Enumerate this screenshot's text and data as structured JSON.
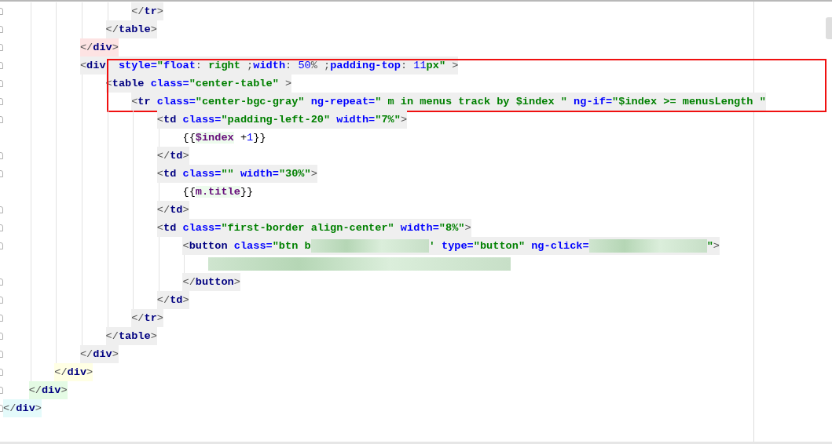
{
  "editor": {
    "lines": [
      {
        "children": [
          {
            "children": [
              {
                "children": [
                  {
                    "children": [
                      {
                        "children": [
                          {
                            "color": "#efefef",
                            "marked": false,
                            "tokens": [
                              {
                                "kind": "punct",
                                "text": "</"
                              },
                              {
                                "kind": "tag",
                                "text": "tr"
                              },
                              {
                                "kind": "punct",
                                "text": ">"
                              }
                            ]
                          }
                        ]
                      },
                      {
                        "color": "#efefef",
                        "marked": false,
                        "tokens": [
                          {
                            "kind": "punct",
                            "text": "</"
                          },
                          {
                            "kind": "tag",
                            "text": "table"
                          },
                          {
                            "kind": "punct",
                            "text": ">"
                          }
                        ]
                      }
                    ]
                  },
                  {
                    "color": "#fde3e3",
                    "marked": false,
                    "tokens": [
                      {
                        "kind": "punct",
                        "text": "</"
                      },
                      {
                        "kind": "tag",
                        "text": "div"
                      },
                      {
                        "kind": "punct",
                        "text": ">"
                      }
                    ]
                  },
                  {
                    "color": "#efefef",
                    "marked": true,
                    "tokens": [
                      {
                        "kind": "punct",
                        "text": "<"
                      },
                      {
                        "kind": "tag",
                        "text": "div"
                      },
                      {
                        "kind": "attr",
                        "text": "  style="
                      },
                      {
                        "kind": "value",
                        "text": "\""
                      },
                      {
                        "kind": "attr",
                        "text": "float"
                      },
                      {
                        "kind": "punct",
                        "text": ": "
                      },
                      {
                        "kind": "value",
                        "text": "right "
                      },
                      {
                        "kind": "punct",
                        "text": ";"
                      },
                      {
                        "kind": "attr",
                        "text": "width"
                      },
                      {
                        "kind": "punct",
                        "text": ": "
                      },
                      {
                        "kind": "number",
                        "text": "50"
                      },
                      {
                        "kind": "punct",
                        "text": "% ;"
                      },
                      {
                        "kind": "attr",
                        "text": "padding-top"
                      },
                      {
                        "kind": "punct",
                        "text": ": "
                      },
                      {
                        "kind": "number",
                        "text": "11"
                      },
                      {
                        "kind": "value",
                        "text": "px\""
                      },
                      {
                        "kind": "punct",
                        "text": " >"
                      }
                    ],
                    "children": [
                      {
                        "color": "#efefef",
                        "marked": true,
                        "tokens": [
                          {
                            "kind": "punct",
                            "text": "<"
                          },
                          {
                            "kind": "tag",
                            "text": "table"
                          },
                          {
                            "kind": "attr",
                            "text": " class="
                          },
                          {
                            "kind": "value",
                            "text": "\"center-table\""
                          },
                          {
                            "kind": "punct",
                            "text": " >"
                          }
                        ],
                        "children": [
                          {
                            "color": "#efefef",
                            "marked": true,
                            "tokens": [
                              {
                                "kind": "punct",
                                "text": "<"
                              },
                              {
                                "kind": "tag",
                                "text": "tr"
                              },
                              {
                                "kind": "attr",
                                "text": " class="
                              },
                              {
                                "kind": "value",
                                "text": "\"center-bgc-gray\""
                              },
                              {
                                "kind": "attr",
                                "text": " ng-repeat="
                              },
                              {
                                "kind": "value",
                                "text": "\" m in menus track by $index \""
                              },
                              {
                                "kind": "attr",
                                "text": " ng-if="
                              },
                              {
                                "kind": "value",
                                "text": "\"$index >= menusLength \""
                              }
                            ],
                            "children": [
                              {
                                "color": "#efefef",
                                "marked": false,
                                "tokens": [
                                  {
                                    "kind": "punct",
                                    "text": "<"
                                  },
                                  {
                                    "kind": "tag",
                                    "text": "td"
                                  },
                                  {
                                    "kind": "attr",
                                    "text": " class="
                                  },
                                  {
                                    "kind": "value",
                                    "text": "\"padding-left-20\""
                                  },
                                  {
                                    "kind": "attr",
                                    "text": " width="
                                  },
                                  {
                                    "kind": "value",
                                    "text": "\"7%\""
                                  },
                                  {
                                    "kind": "punct",
                                    "text": ">"
                                  }
                                ],
                                "children": [
                                  {
                                    "color": "#ffffff",
                                    "marked": false,
                                    "tokens": [
                                      {
                                        "kind": "plain",
                                        "text": "{{"
                                      },
                                      {
                                        "kind": "var",
                                        "text": "$index"
                                      },
                                      {
                                        "kind": "plain",
                                        "text": " +"
                                      },
                                      {
                                        "kind": "number",
                                        "text": "1"
                                      },
                                      {
                                        "kind": "plain",
                                        "text": "}}"
                                      }
                                    ]
                                  }
                                ]
                              },
                              {
                                "color": "#efefef",
                                "marked": false,
                                "tokens": [
                                  {
                                    "kind": "punct",
                                    "text": "</"
                                  },
                                  {
                                    "kind": "tag",
                                    "text": "td"
                                  },
                                  {
                                    "kind": "punct",
                                    "text": ">"
                                  }
                                ]
                              },
                              {
                                "color": "#efefef",
                                "marked": false,
                                "tokens": [
                                  {
                                    "kind": "punct",
                                    "text": "<"
                                  },
                                  {
                                    "kind": "tag",
                                    "text": "td"
                                  },
                                  {
                                    "kind": "attr",
                                    "text": " class="
                                  },
                                  {
                                    "kind": "value",
                                    "text": "\"\""
                                  },
                                  {
                                    "kind": "attr",
                                    "text": " width="
                                  },
                                  {
                                    "kind": "value",
                                    "text": "\"30%\""
                                  },
                                  {
                                    "kind": "punct",
                                    "text": ">"
                                  }
                                ],
                                "children": [
                                  {
                                    "color": "#ffffff",
                                    "marked": false,
                                    "tokens": [
                                      {
                                        "kind": "plain",
                                        "text": "{{"
                                      },
                                      {
                                        "kind": "var",
                                        "text": "m.title"
                                      },
                                      {
                                        "kind": "plain",
                                        "text": "}}"
                                      }
                                    ]
                                  }
                                ]
                              },
                              {
                                "color": "#efefef",
                                "marked": false,
                                "tokens": [
                                  {
                                    "kind": "punct",
                                    "text": "</"
                                  },
                                  {
                                    "kind": "tag",
                                    "text": "td"
                                  },
                                  {
                                    "kind": "punct",
                                    "text": ">"
                                  }
                                ]
                              },
                              {
                                "color": "#efefef",
                                "marked": false,
                                "tokens": [
                                  {
                                    "kind": "punct",
                                    "text": "<"
                                  },
                                  {
                                    "kind": "tag",
                                    "text": "td"
                                  },
                                  {
                                    "kind": "attr",
                                    "text": " class="
                                  },
                                  {
                                    "kind": "value",
                                    "text": "\"first-border align-center\""
                                  },
                                  {
                                    "kind": "attr",
                                    "text": " width="
                                  },
                                  {
                                    "kind": "value",
                                    "text": "\"8%\""
                                  },
                                  {
                                    "kind": "punct",
                                    "text": ">"
                                  }
                                ],
                                "children": [
                                  {
                                    "color": "#efefef",
                                    "marked": false,
                                    "tokens": [
                                      {
                                        "kind": "punct",
                                        "text": "<"
                                      },
                                      {
                                        "kind": "tag",
                                        "text": "button"
                                      },
                                      {
                                        "kind": "attr",
                                        "text": " class="
                                      },
                                      {
                                        "kind": "value",
                                        "text": "\"btn b"
                                      },
                                      {
                                        "kind": "redacted"
                                      },
                                      {
                                        "kind": "value",
                                        "text": "'"
                                      },
                                      {
                                        "kind": "attr",
                                        "text": " type="
                                      },
                                      {
                                        "kind": "value",
                                        "text": "\"button\""
                                      },
                                      {
                                        "kind": "attr",
                                        "text": " ng-click="
                                      },
                                      {
                                        "kind": "redacted"
                                      },
                                      {
                                        "kind": "value",
                                        "text": "\""
                                      },
                                      {
                                        "kind": "punct",
                                        "text": ">"
                                      }
                                    ],
                                    "children": [
                                      {
                                        "color": "#ffffff",
                                        "marked": false,
                                        "tokens": [
                                          {
                                            "kind": "redacted"
                                          }
                                        ]
                                      }
                                    ]
                                  },
                                  {
                                    "color": "#efefef",
                                    "marked": false,
                                    "tokens": [
                                      {
                                        "kind": "punct",
                                        "text": "</"
                                      },
                                      {
                                        "kind": "tag",
                                        "text": "button"
                                      },
                                      {
                                        "kind": "punct",
                                        "text": ">"
                                      }
                                    ]
                                  }
                                ]
                              },
                              {
                                "color": "#efefef",
                                "marked": false,
                                "tokens": [
                                  {
                                    "kind": "punct",
                                    "text": "</"
                                  },
                                  {
                                    "kind": "tag",
                                    "text": "td"
                                  },
                                  {
                                    "kind": "punct",
                                    "text": ">"
                                  }
                                ]
                              }
                            ]
                          },
                          {
                            "color": "#efefef",
                            "marked": false,
                            "tokens": [
                              {
                                "kind": "punct",
                                "text": "</"
                              },
                              {
                                "kind": "tag",
                                "text": "tr"
                              },
                              {
                                "kind": "punct",
                                "text": ">"
                              }
                            ]
                          }
                        ]
                      },
                      {
                        "color": "#efefef",
                        "marked": false,
                        "tokens": [
                          {
                            "kind": "punct",
                            "text": "</"
                          },
                          {
                            "kind": "tag",
                            "text": "table"
                          },
                          {
                            "kind": "punct",
                            "text": ">"
                          }
                        ]
                      }
                    ]
                  },
                  {
                    "color": "#efefef",
                    "marked": false,
                    "tokens": [
                      {
                        "kind": "punct",
                        "text": "</"
                      },
                      {
                        "kind": "tag",
                        "text": "div"
                      },
                      {
                        "kind": "punct",
                        "text": ">"
                      }
                    ]
                  }
                ]
              },
              {
                "color": "#ffffe4",
                "marked": false,
                "tokens": [
                  {
                    "kind": "punct",
                    "text": "</"
                  },
                  {
                    "kind": "tag",
                    "text": "div"
                  },
                  {
                    "kind": "punct",
                    "text": ">"
                  }
                ]
              }
            ]
          },
          {
            "color": "#e4fbe4",
            "marked": false,
            "tokens": [
              {
                "kind": "punct",
                "text": "</"
              },
              {
                "kind": "tag",
                "text": "div"
              },
              {
                "kind": "punct",
                "text": ">"
              }
            ]
          }
        ]
      },
      {
        "color": "#e4fafa",
        "marked": false,
        "tokens": [
          {
            "kind": "punct",
            "text": "</"
          },
          {
            "kind": "tag",
            "text": "div"
          },
          {
            "kind": "punct",
            "text": ">"
          }
        ]
      }
    ]
  }
}
